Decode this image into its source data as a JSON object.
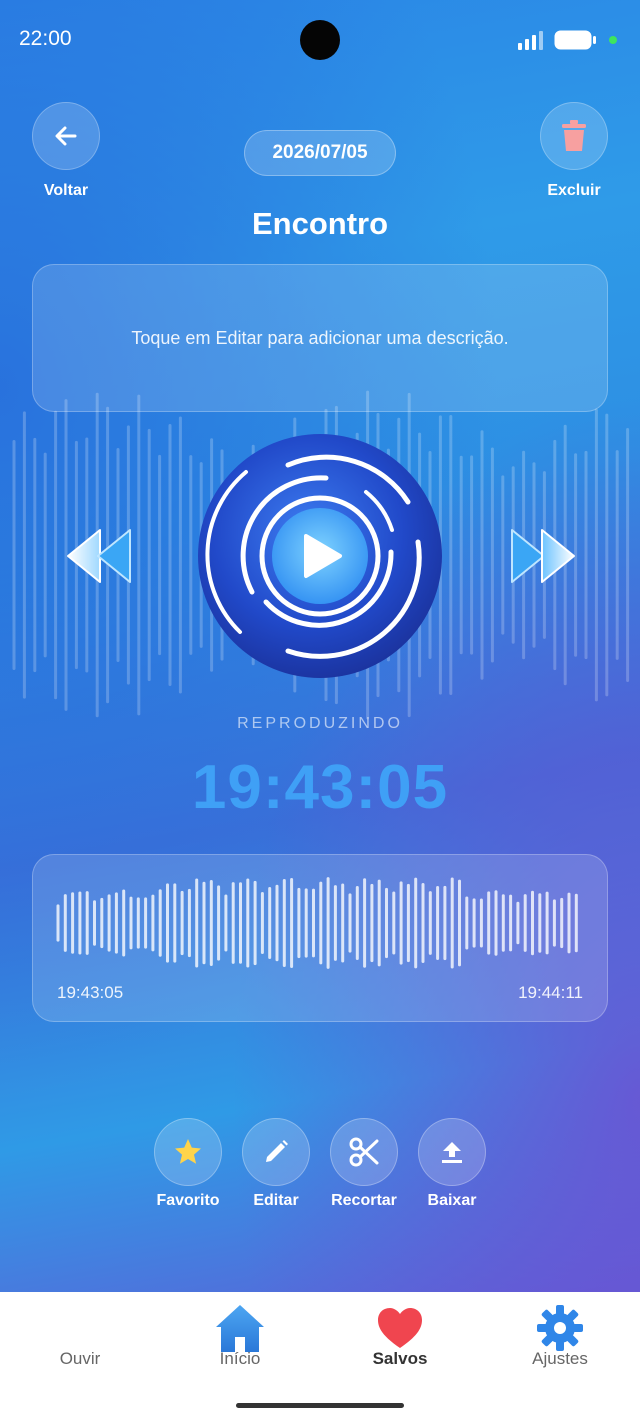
{
  "status_bar": {
    "time": "22:00"
  },
  "header": {
    "back_label": "Voltar",
    "delete_label": "Excluir",
    "date": "2026/07/05",
    "title": "Encontro"
  },
  "description": {
    "placeholder": "Toque em Editar para adicionar uma descrição."
  },
  "player": {
    "status": "REPRODUZINDO",
    "current_time": "19:43:05",
    "range_start": "19:43:05",
    "range_end": "19:44:11"
  },
  "actions": [
    {
      "label": "Favorito",
      "icon": "star-icon"
    },
    {
      "label": "Editar",
      "icon": "pencil-icon"
    },
    {
      "label": "Recortar",
      "icon": "scissors-icon"
    },
    {
      "label": "Baixar",
      "icon": "upload-icon"
    }
  ],
  "nav": [
    {
      "label": "Ouvir",
      "icon": "waveform-icon",
      "active": false
    },
    {
      "label": "Início",
      "icon": "home-icon",
      "active": false
    },
    {
      "label": "Salvos",
      "icon": "heart-icon",
      "active": true
    },
    {
      "label": "Ajustes",
      "icon": "gear-icon",
      "active": false
    }
  ],
  "colors": {
    "accent": "#3fa0f6",
    "heart": "#f0454f",
    "star": "#ffd44a",
    "trash": "#f7a0a0"
  }
}
